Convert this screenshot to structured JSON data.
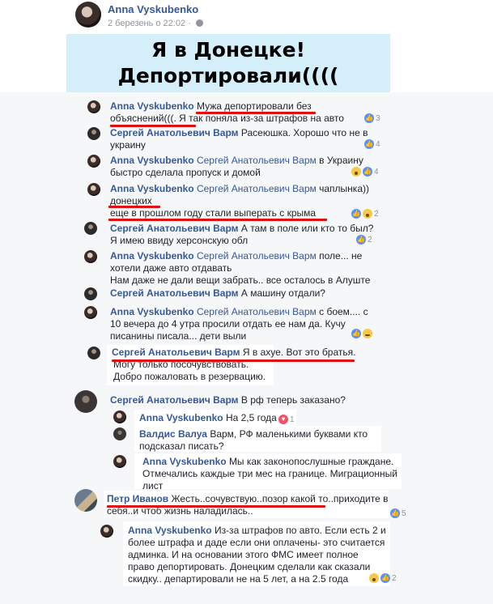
{
  "post": {
    "author": "Anna Vyskubenko",
    "time": "2 березень о 22:02 · ",
    "banner_line1": "Я в Донецке!",
    "banner_line2": "Депортировали(((("
  },
  "comments": [
    {
      "name": "Anna Vyskubenko",
      "lines": [
        "Мужа депортировали без",
        "объяснений(((. Я так поняла из-за штрафов на авто"
      ],
      "reaction_count": "3"
    },
    {
      "name": "Сергей Анатольевич Варм",
      "lines": [
        "Расеюшка. Хорошо что не в",
        "украину"
      ],
      "reaction_count": "4"
    },
    {
      "name": "Anna Vyskubenko",
      "mention": "Сергей Анатольевич Варм",
      "lines": [
        "в Украину",
        "быстро сделала пропуск и домой"
      ],
      "reaction_count": "4"
    },
    {
      "name": "Anna Vyskubenko",
      "mention": "Сергей Анатольевич Варм",
      "lines": [
        "чаплынка))",
        "донецких",
        "еще в прошлом году стали выперать с крыма"
      ],
      "reaction_count": "2"
    },
    {
      "name": "Сергей Анатольевич Варм",
      "lines": [
        "А там в поле или кто то был?",
        "Я имею ввиду херсонскую обл"
      ],
      "reaction_count": "2"
    },
    {
      "name": "Anna Vyskubenko",
      "mention": "Сергей Анатольевич Варм",
      "lines": [
        "поле... не",
        "хотели даже авто отдавать",
        "Нам даже не дали вещи забрать.. все   осталось в Алуште"
      ]
    },
    {
      "name": "Сергей Анатольевич Варм",
      "lines": [
        "А машину отдали?"
      ]
    },
    {
      "name": "Anna Vyskubenko",
      "mention": "Сергей Анатольевич Варм",
      "lines": [
        "с боем.... с",
        "10 вечера до 4 утра просили отдать ее нам     да. Кучу",
        "писанины писала... дети выли"
      ]
    },
    {
      "name": "Сергей Анатольевич Варм",
      "lines": [
        "Я в ахуе. Вот это братья.",
        "Могу только посочувствовать.",
        "Добро пожаловать в резервацию."
      ]
    },
    {
      "name": "Сергей Анатольевич Варм",
      "lines": [
        "В рф теперь заказано?"
      ]
    },
    {
      "name": "Anna Vyskubenko",
      "lines": [
        "На 2,5 года"
      ],
      "reaction_count": "1"
    },
    {
      "name": "Валдис Валуа",
      "lines": [
        "Варм, РФ маленькими буквами кто",
        "подсказал писать?"
      ]
    },
    {
      "name": "Anna Vyskubenko",
      "lines": [
        "Мы как законопослушные граждане.",
        "Отмечались каждые три мес на границе. Миграционный",
        "лист"
      ]
    },
    {
      "name": "Петр Иванов",
      "lines": [
        "Жесть..сочувствую..позор какой то..приходите в",
        "себя..и чтоб жизнь наладилась.."
      ],
      "reaction_count": "5"
    },
    {
      "name": "Anna Vyskubenko",
      "lines": [
        "Из-за штрафов по авто. Если есть 2 и",
        "более штрафа и даде если они оплачены- это считается",
        "админка. И на основании этого ФМС имеет полное",
        "право депортировать. Донецким сделали как сказали",
        "скидку.. департировали не на 5 лет, а на 2.5 года"
      ],
      "reaction_count": "2"
    }
  ]
}
